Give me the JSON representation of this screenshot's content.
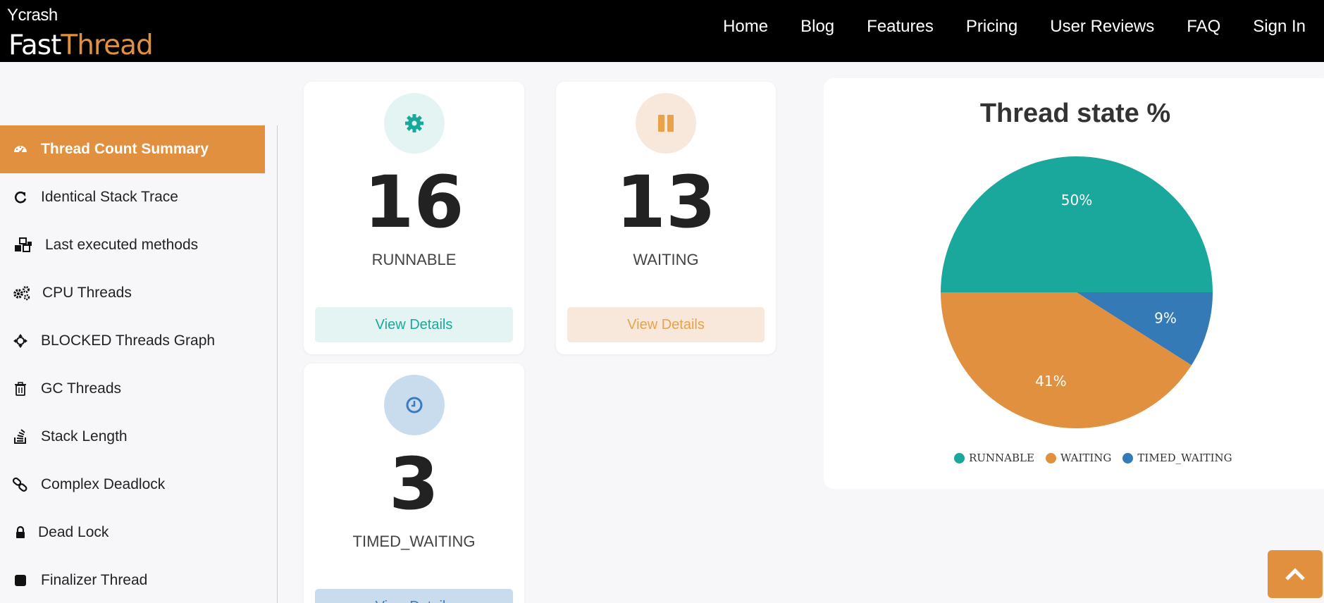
{
  "brand": {
    "small": "crash",
    "fast": "Fast",
    "thread": "Thread"
  },
  "nav": [
    "Home",
    "Blog",
    "Features",
    "Pricing",
    "User Reviews",
    "FAQ",
    "Sign In"
  ],
  "sidebar": [
    {
      "label": "Thread Count Summary",
      "icon": "dashboard-icon",
      "active": true
    },
    {
      "label": "Identical Stack Trace",
      "icon": "refresh-icon"
    },
    {
      "label": "Last executed methods",
      "icon": "cubes-icon"
    },
    {
      "label": "CPU Threads",
      "icon": "gears-icon"
    },
    {
      "label": "BLOCKED Threads Graph",
      "icon": "crosshair-icon"
    },
    {
      "label": "GC Threads",
      "icon": "trash-icon"
    },
    {
      "label": "Stack Length",
      "icon": "stack-icon"
    },
    {
      "label": "Complex Deadlock",
      "icon": "link-icon"
    },
    {
      "label": "Dead Lock",
      "icon": "lock-icon"
    },
    {
      "label": "Finalizer Thread",
      "icon": "square-icon"
    }
  ],
  "cards": [
    {
      "value": "16",
      "label": "RUNNABLE",
      "button": "View Details",
      "icon": "gear-icon",
      "accent": "#1aa89c",
      "bg": "#e4f4f3"
    },
    {
      "value": "13",
      "label": "WAITING",
      "button": "View Details",
      "icon": "pause-icon",
      "accent": "#e9a24a",
      "bg": "#f8e8dc"
    },
    {
      "value": "3",
      "label": "TIMED_WAITING",
      "button": "View Details",
      "icon": "clock-icon",
      "accent": "#3a7bbf",
      "bg": "#c9dcee"
    }
  ],
  "chart_data": {
    "type": "pie",
    "title": "Thread state %",
    "slices": [
      {
        "label": "RUNNABLE",
        "value": 50,
        "color": "#1aa89c",
        "text": "50%"
      },
      {
        "label": "TIMED_WAITING",
        "value": 9,
        "color": "#337ab7",
        "text": "9%"
      },
      {
        "label": "WAITING",
        "value": 41,
        "color": "#e0903f",
        "text": "41%"
      }
    ],
    "legend": [
      "RUNNABLE",
      "WAITING",
      "TIMED_WAITING"
    ],
    "legend_position": "bottom"
  },
  "scroll_top": {
    "icon": "chevron-up-icon"
  }
}
